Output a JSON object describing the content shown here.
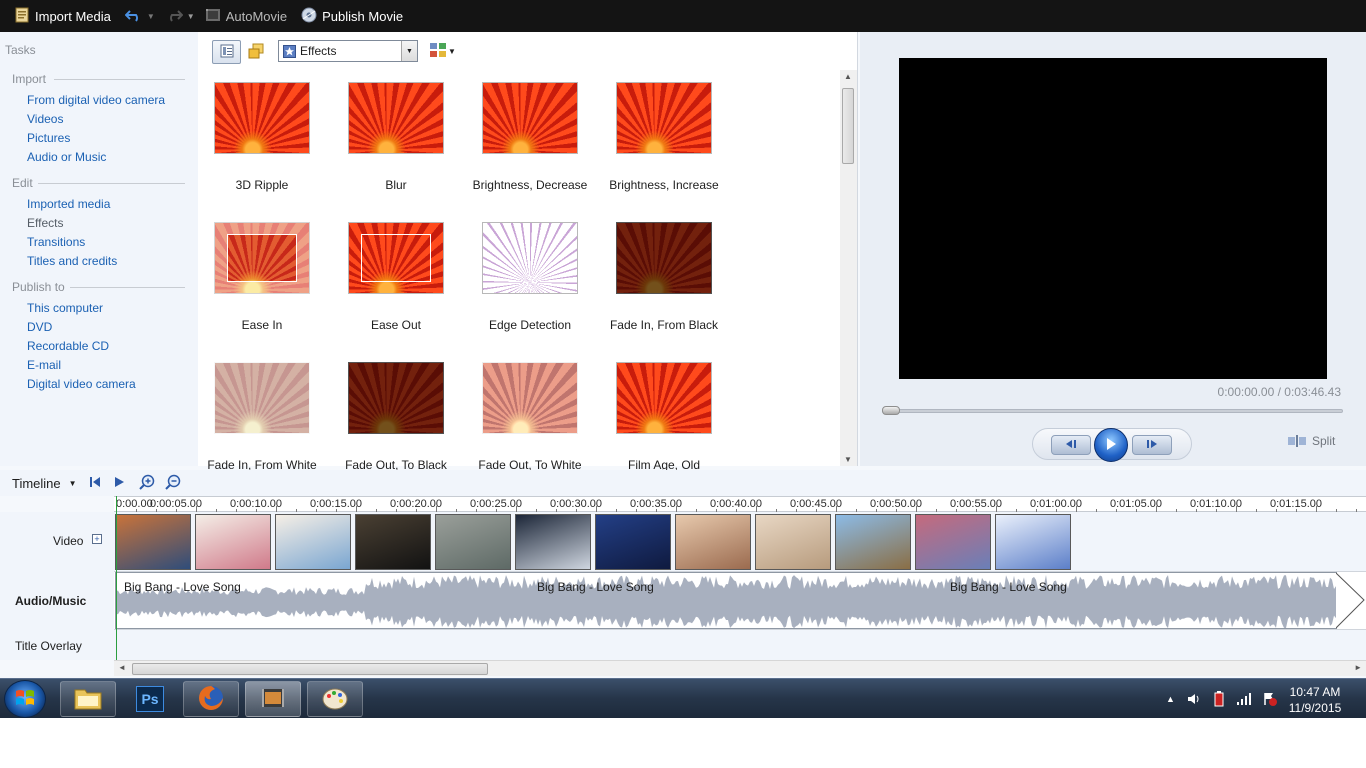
{
  "toolbar": {
    "import_label": "Import Media",
    "automovie_label": "AutoMovie",
    "publish_label": "Publish Movie"
  },
  "tasks": {
    "title": "Tasks",
    "sections": [
      {
        "header": "Import",
        "links": [
          "From digital video camera",
          "Videos",
          "Pictures",
          "Audio or Music"
        ]
      },
      {
        "header": "Edit",
        "links": [
          "Imported media",
          "Effects",
          "Transitions",
          "Titles and credits"
        ]
      },
      {
        "header": "Publish to",
        "links": [
          "This computer",
          "DVD",
          "Recordable CD",
          "E-mail",
          "Digital video camera"
        ]
      }
    ],
    "current": "Effects"
  },
  "effects": {
    "dropdown": "Effects",
    "items": [
      {
        "label": "3D Ripple",
        "style": "normal"
      },
      {
        "label": "Blur",
        "style": "normal"
      },
      {
        "label": "Brightness, Decrease",
        "style": "normal"
      },
      {
        "label": "Brightness, Increase",
        "style": "normal"
      },
      {
        "label": "Ease In",
        "style": "easein"
      },
      {
        "label": "Ease Out",
        "style": "easeout"
      },
      {
        "label": "Edge Detection",
        "style": "edge"
      },
      {
        "label": "Fade In, From Black",
        "style": "dark"
      },
      {
        "label": "Fade In, From White",
        "style": "white"
      },
      {
        "label": "Fade Out, To Black",
        "style": "dark"
      },
      {
        "label": "Fade Out, To White",
        "style": "pale"
      },
      {
        "label": "Film Age, Old",
        "style": "normal"
      }
    ]
  },
  "preview": {
    "time": "0:00:00.00 / 0:03:46.43",
    "split_label": "Split"
  },
  "timeline": {
    "label": "Timeline",
    "ruler": [
      "0:00.00",
      "0:00:05.00",
      "0:00:10.00",
      "0:00:15.00",
      "0:00:20.00",
      "0:00:25.00",
      "0:00:30.00",
      "0:00:35.00",
      "0:00:40.00",
      "0:00:45.00",
      "0:00:50.00",
      "0:00:55.00",
      "0:01:00.00",
      "0:01:05.00",
      "0:01:10.00",
      "0:01:15.00"
    ],
    "tracks": {
      "video": "Video",
      "audio": "Audio/Music",
      "overlay": "Title Overlay"
    },
    "clips": [
      {
        "name": "venice",
        "c1": "#c9733a",
        "c2": "#2f4d7a"
      },
      {
        "name": "cartoon couple",
        "c1": "#f4eee7",
        "c2": "#d07a8a"
      },
      {
        "name": "cartoon couple",
        "c1": "#f6efe6",
        "c2": "#7aa6d1"
      },
      {
        "name": "dark alley",
        "c1": "#4a4033",
        "c2": "#121212"
      },
      {
        "name": "sneakers",
        "c1": "#9a9f9a",
        "c2": "#5e6a66"
      },
      {
        "name": "collage",
        "c1": "#1c2638",
        "c2": "#cfd6e0"
      },
      {
        "name": "city night",
        "c1": "#233f86",
        "c2": "#0f1a3f"
      },
      {
        "name": "pendant",
        "c1": "#e7c9ad",
        "c2": "#9b6b4f"
      },
      {
        "name": "woman",
        "c1": "#e8d7c4",
        "c2": "#b79b7d"
      },
      {
        "name": "big ben",
        "c1": "#8cbbe6",
        "c2": "#8a6e45"
      },
      {
        "name": "petals",
        "c1": "#c56a7d",
        "c2": "#6a7fb8"
      },
      {
        "name": "reading girl",
        "c1": "#eaf0fb",
        "c2": "#5c7fc9"
      }
    ],
    "audio_title": "Big Bang - Love Song"
  },
  "taskbar": {
    "apps": [
      "explorer",
      "photoshop",
      "firefox",
      "movie-maker",
      "paint"
    ],
    "photoshop_label": "Ps",
    "time": "10:47 AM",
    "date": "11/9/2015"
  },
  "colors": {
    "accent": "#1b61b3",
    "toolbar_bg": "#141414",
    "effect_orange": "#e2331a",
    "audio_wave": "#a8b0bf"
  }
}
